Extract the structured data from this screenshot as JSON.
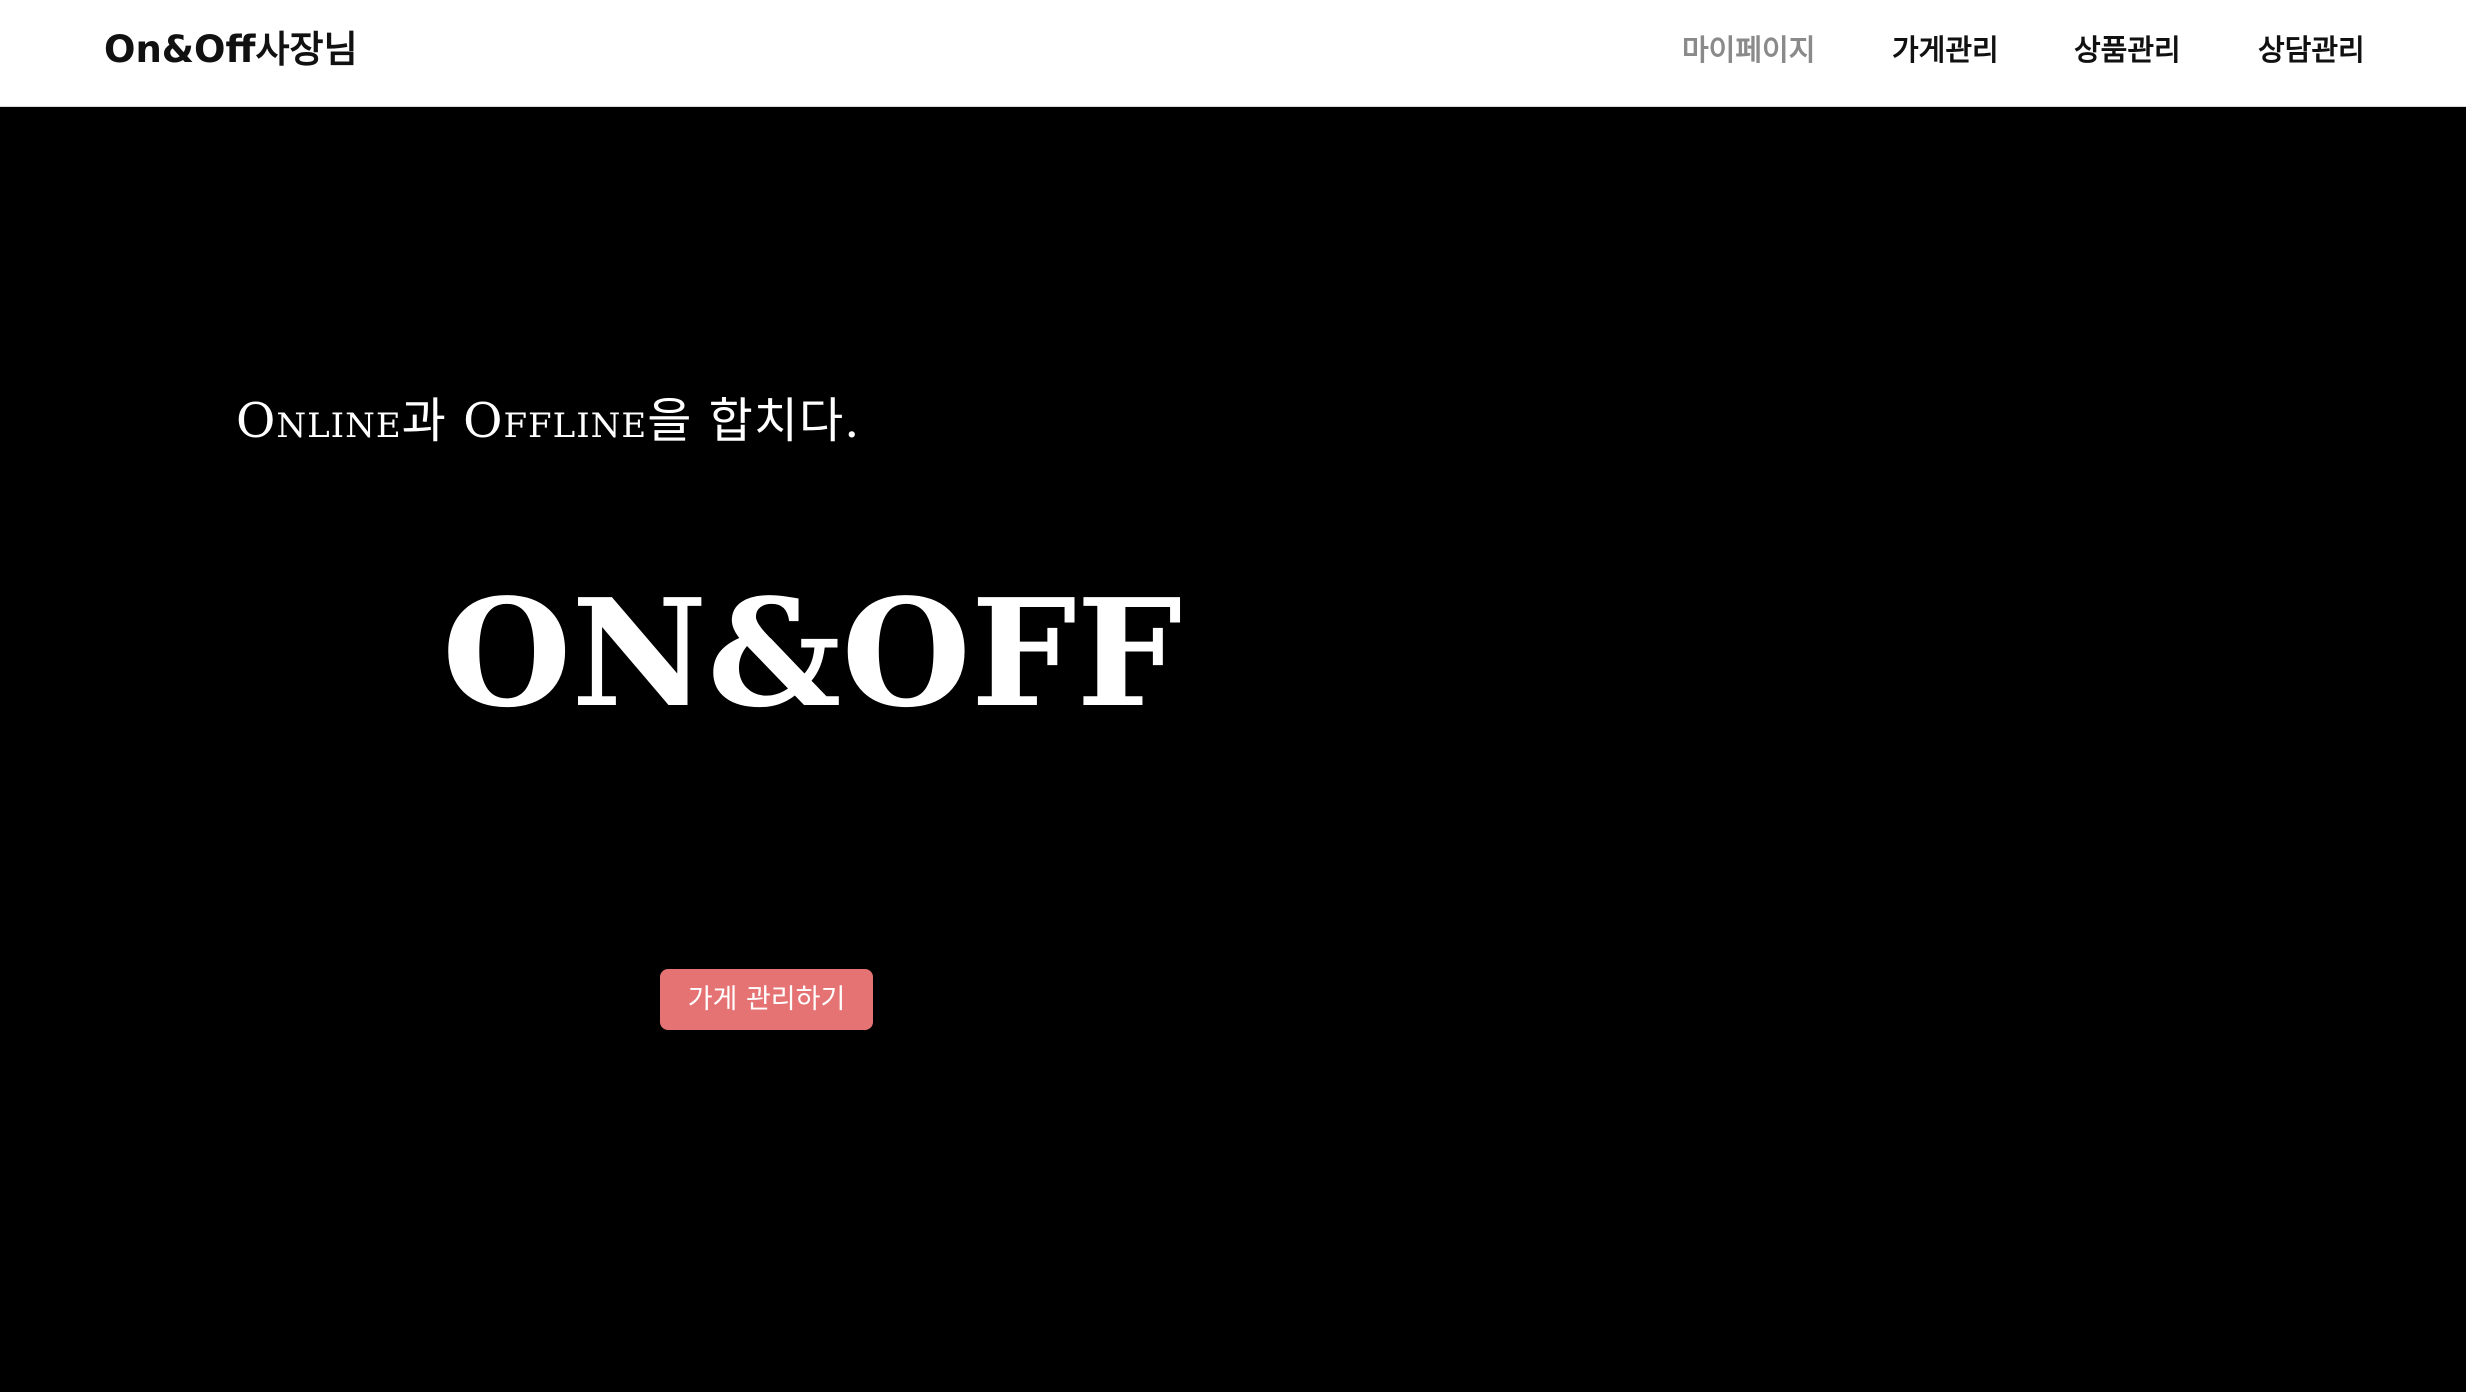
{
  "header": {
    "brand": "On&Off사장님",
    "nav": [
      {
        "label": "마이페이지",
        "active": true
      },
      {
        "label": "가게관리",
        "active": false
      },
      {
        "label": "상품관리",
        "active": false
      },
      {
        "label": "상담관리",
        "active": false
      }
    ]
  },
  "hero": {
    "tagline": "Online과 Offline을 합치다.",
    "logo_text": "ON&OFF",
    "cta_label": "가게 관리하기",
    "cta_color": "#e57373"
  },
  "colors": {
    "header_bg": "#ffffff",
    "hero_bg": "#000000",
    "nav_active": "#8a8a8a",
    "text_dark": "#111111",
    "text_light": "#ffffff"
  }
}
